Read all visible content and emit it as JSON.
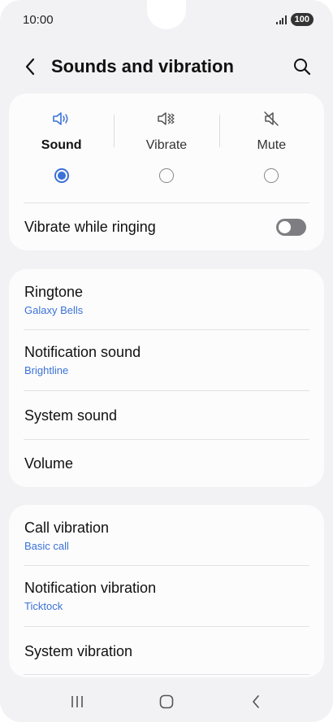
{
  "status_bar": {
    "time": "10:00",
    "battery": "100"
  },
  "header": {
    "title": "Sounds and vibration"
  },
  "sound_modes": [
    {
      "label": "Sound",
      "selected": true,
      "icon": "speaker-icon"
    },
    {
      "label": "Vibrate",
      "selected": false,
      "icon": "vibrate-icon"
    },
    {
      "label": "Mute",
      "selected": false,
      "icon": "mute-icon"
    }
  ],
  "vibrate_while_ringing": {
    "label": "Vibrate while ringing",
    "enabled": false
  },
  "sounds_section": {
    "ringtone": {
      "title": "Ringtone",
      "value": "Galaxy Bells"
    },
    "notification_sound": {
      "title": "Notification sound",
      "value": "Brightline"
    },
    "system_sound": {
      "title": "System sound"
    },
    "volume": {
      "title": "Volume"
    }
  },
  "vibration_section": {
    "call_vibration": {
      "title": "Call vibration",
      "value": "Basic call"
    },
    "notification_vibration": {
      "title": "Notification vibration",
      "value": "Ticktock"
    },
    "system_vibration": {
      "title": "System vibration"
    }
  },
  "colors": {
    "accent": "#3b72d6",
    "background": "#f2f2f4",
    "card": "#fcfcfd"
  }
}
